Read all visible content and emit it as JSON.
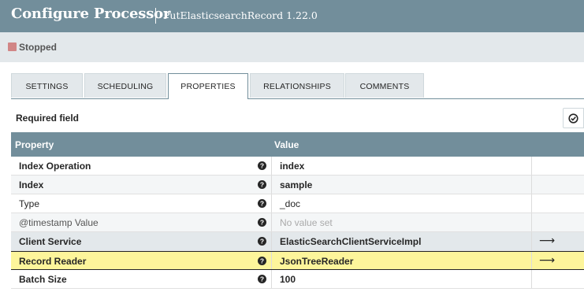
{
  "header": {
    "title": "Configure Processor",
    "subtitle": "PutElasticsearchRecord 1.22.0"
  },
  "status": {
    "label": "Stopped",
    "color": "#d18686"
  },
  "tabs": [
    {
      "label": "SETTINGS",
      "active": false
    },
    {
      "label": "SCHEDULING",
      "active": false
    },
    {
      "label": "PROPERTIES",
      "active": true
    },
    {
      "label": "RELATIONSHIPS",
      "active": false
    },
    {
      "label": "COMMENTS",
      "active": false
    }
  ],
  "required_field_label": "Required field",
  "verify_icon": "check-circle-icon",
  "grid": {
    "headers": {
      "property": "Property",
      "value": "Value"
    },
    "rows": [
      {
        "property": "Index Operation",
        "value": "index",
        "required": true,
        "placeholder": false,
        "has_arrow": false
      },
      {
        "property": "Index",
        "value": "sample",
        "required": true,
        "placeholder": false,
        "has_arrow": false
      },
      {
        "property": "Type",
        "value": "_doc",
        "required": false,
        "placeholder": false,
        "has_arrow": false
      },
      {
        "property": "@timestamp Value",
        "value": "No value set",
        "required": false,
        "placeholder": true,
        "has_arrow": false
      },
      {
        "property": "Client Service",
        "value": "ElasticSearchClientServiceImpl",
        "required": true,
        "placeholder": false,
        "has_arrow": true
      },
      {
        "property": "Record Reader",
        "value": "JsonTreeReader",
        "required": true,
        "placeholder": false,
        "has_arrow": true
      },
      {
        "property": "Batch Size",
        "value": "100",
        "required": true,
        "placeholder": false,
        "has_arrow": false
      }
    ],
    "arrow_glyph": "⟶"
  },
  "colors": {
    "header_bg": "#728e9b",
    "highlight_row": "#fdf59b"
  }
}
